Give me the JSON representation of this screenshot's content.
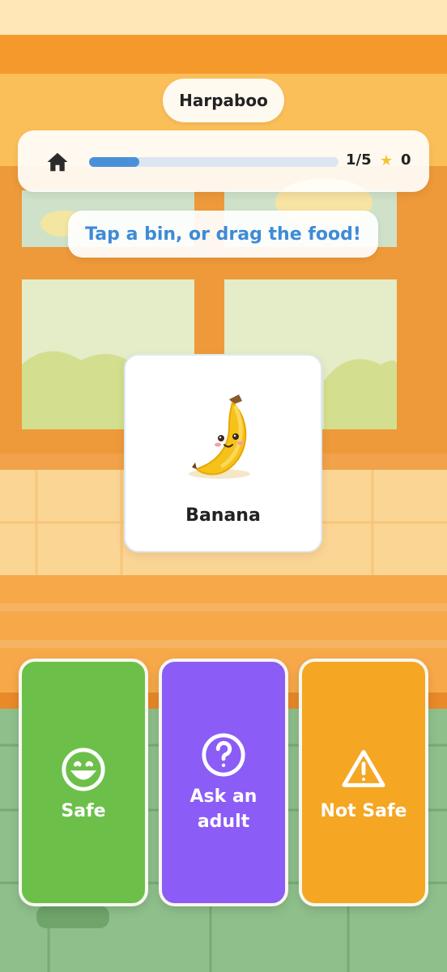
{
  "app": {
    "title": "Harpaboo"
  },
  "header": {
    "home_icon": "home-icon",
    "progress_fraction": 0.2,
    "progress_text": "1/5",
    "star_icon": "star-icon",
    "score": "0"
  },
  "hint": "Tap a bin, or drag the food!",
  "food": {
    "name": "Banana",
    "image": "banana-illustration"
  },
  "bins": [
    {
      "label": "Safe",
      "icon": "smile-icon",
      "color": "#6cc04a"
    },
    {
      "label": "Ask an\nadult",
      "icon": "question-icon",
      "color": "#8b5cf6"
    },
    {
      "label": "Not Safe",
      "icon": "warning-icon",
      "color": "#f5a623"
    }
  ]
}
